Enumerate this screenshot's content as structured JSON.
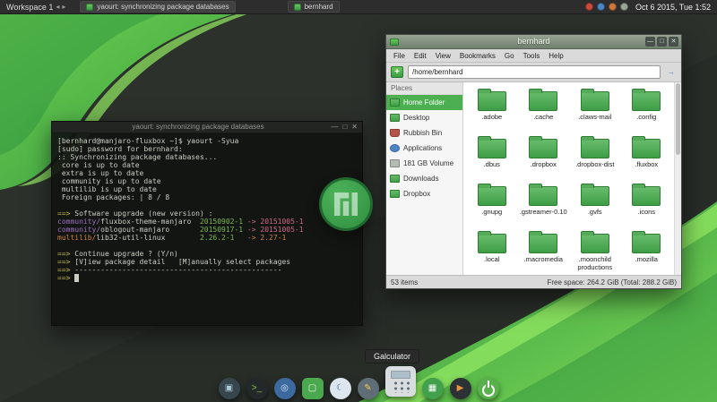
{
  "panel": {
    "workspace": "Workspace 1",
    "tasks": [
      {
        "label": "yaourt: synchronizing package databases"
      },
      {
        "label": "bernhard"
      }
    ],
    "tray": [
      {
        "name": "update-indicator-icon",
        "color": "#cb4b3c"
      },
      {
        "name": "network-icon",
        "color": "#4d86c6"
      },
      {
        "name": "notification-icon",
        "color": "#cb7a3c"
      },
      {
        "name": "volume-icon",
        "color": "#9aa59a"
      }
    ],
    "clock": "Oct 6 2015, Tue 1:52"
  },
  "icons": {
    "minimize": "—",
    "maximize": "□",
    "close": "✕",
    "new_tab": "+",
    "go": "→",
    "workspace_prev": "◂",
    "workspace_next": "▸"
  },
  "terminal": {
    "title": "yaourt: synchronizing package databases",
    "lines": [
      [
        {
          "t": "[bernhard@manjaro-fluxbox ~]$ yaourt -Syua",
          "c": "w"
        }
      ],
      [
        {
          "t": "[sudo] password for bernhard:",
          "c": "w"
        }
      ],
      [
        {
          "t": ":: Synchronizing package databases...",
          "c": "w"
        }
      ],
      [
        {
          "t": " core is up to date",
          "c": "w"
        }
      ],
      [
        {
          "t": " extra is up to date",
          "c": "w"
        }
      ],
      [
        {
          "t": " community is up to date",
          "c": "w"
        }
      ],
      [
        {
          "t": " multilib is up to date",
          "c": "w"
        }
      ],
      [
        {
          "t": " Foreign packages: | 8 / 8",
          "c": "w"
        }
      ],
      [],
      [
        {
          "t": "==> ",
          "c": "y"
        },
        {
          "t": "Software upgrade (new version) :",
          "c": "w"
        }
      ],
      [
        {
          "t": "community/",
          "c": "m"
        },
        {
          "t": "fluxbox-theme-manjaro  ",
          "c": "w"
        },
        {
          "t": "20150902-1",
          "c": "g"
        },
        {
          "t": " -> ",
          "c": "r"
        },
        {
          "t": "20151005-1",
          "c": "r"
        }
      ],
      [
        {
          "t": "community/",
          "c": "m"
        },
        {
          "t": "oblogout-manjaro       ",
          "c": "w"
        },
        {
          "t": "20150917-1",
          "c": "g"
        },
        {
          "t": " -> ",
          "c": "r"
        },
        {
          "t": "20151005-1",
          "c": "r"
        }
      ],
      [
        {
          "t": "multilib/",
          "c": "o"
        },
        {
          "t": "lib32-util-linux        ",
          "c": "w"
        },
        {
          "t": "2.26.2-1",
          "c": "g"
        },
        {
          "t": "   -> ",
          "c": "o"
        },
        {
          "t": "2.27-1",
          "c": "o"
        }
      ],
      [],
      [
        {
          "t": "==> ",
          "c": "y"
        },
        {
          "t": "Continue upgrade ? (Y/n)",
          "c": "w"
        }
      ],
      [
        {
          "t": "==> ",
          "c": "y"
        },
        {
          "t": "[V]iew package detail   [M]anually select packages",
          "c": "w"
        }
      ],
      [
        {
          "t": "==> ",
          "c": "y"
        },
        {
          "t": "------------------------------------------------",
          "c": "w"
        }
      ],
      [
        {
          "t": "==> ",
          "c": "y"
        },
        {
          "t": " ",
          "c": "cur"
        }
      ]
    ]
  },
  "filemanager": {
    "title": "bernhard",
    "menu": [
      "File",
      "Edit",
      "View",
      "Bookmarks",
      "Go",
      "Tools",
      "Help"
    ],
    "path": "/home/bernhard",
    "places_header": "Places",
    "places": [
      {
        "label": "Home Folder",
        "icon": "home-folder-icon",
        "selected": true
      },
      {
        "label": "Desktop",
        "icon": "desktop-folder-icon"
      },
      {
        "label": "Rubbish Bin",
        "icon": "trash-icon"
      },
      {
        "label": "Applications",
        "icon": "applications-icon"
      },
      {
        "label": "181 GB Volume",
        "icon": "drive-icon"
      },
      {
        "label": "Downloads",
        "icon": "downloads-folder-icon"
      },
      {
        "label": "Dropbox",
        "icon": "dropbox-folder-icon"
      }
    ],
    "folders": [
      ".adobe",
      ".cache",
      ".claws-mail",
      ".config",
      ".dbus",
      ".dropbox",
      ".dropbox-dist",
      ".fluxbox",
      ".gnupg",
      ".gstreamer-0.10",
      ".gvfs",
      ".icons",
      ".local",
      ".macromedia",
      ".moonchild productions",
      ".mozilla"
    ],
    "status_items": "53 items",
    "status_free": "Free space: 264.2 GiB (Total: 288.2 GiB)"
  },
  "tooltip": "Galculator",
  "dock": [
    {
      "name": "system-monitor",
      "bg": "#37454c",
      "fg": "#a8c8d8",
      "glyph": "▣"
    },
    {
      "name": "terminal",
      "bg": "#23282b",
      "fg": "#86c443",
      "glyph": ">_"
    },
    {
      "name": "browser",
      "bg": "#3d6a9e",
      "fg": "#d6e6f5",
      "glyph": "◎"
    },
    {
      "name": "file-manager",
      "bg": "#4aa84e",
      "fg": "#eef7ee",
      "glyph": "▢",
      "square": true
    },
    {
      "name": "palemoon",
      "bg": "#dde6ee",
      "fg": "#3a6ca8",
      "glyph": "☾"
    },
    {
      "name": "text-editor",
      "bg": "#5f6e76",
      "fg": "#f3c94f",
      "glyph": "✎"
    },
    {
      "name": "calculator",
      "bg": "#d9dde0",
      "fg": "#444444",
      "glyph": "",
      "big": true,
      "square": true
    },
    {
      "name": "app-launcher",
      "bg": "#41a04c",
      "fg": "#ffffff",
      "glyph": "▦"
    },
    {
      "name": "media-player",
      "bg": "#2c3136",
      "fg": "#e8923a",
      "glyph": "▶"
    },
    {
      "name": "power",
      "bg": "#58b14c",
      "fg": "#ffffff",
      "glyph": ""
    }
  ]
}
